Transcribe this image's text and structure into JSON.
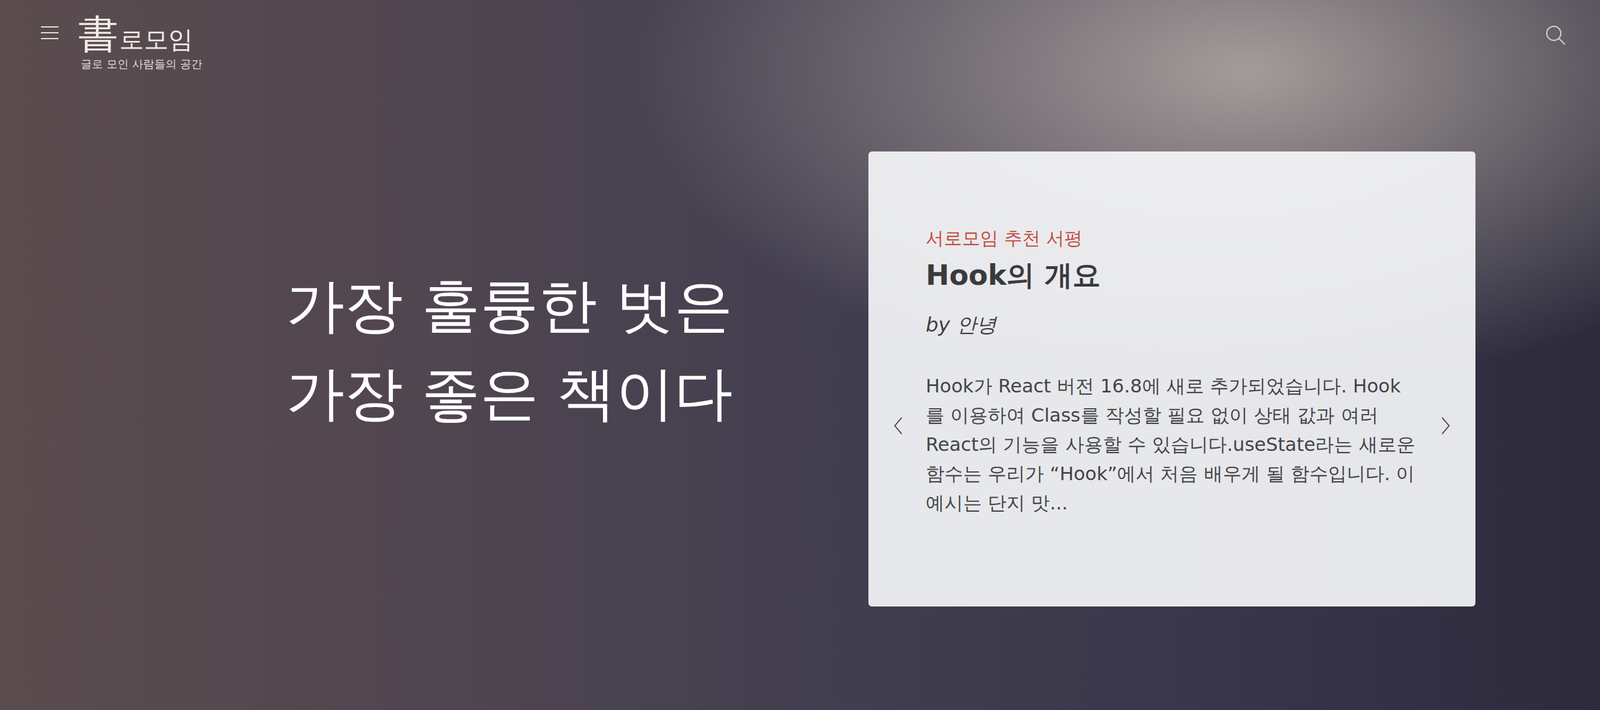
{
  "header": {
    "logo": {
      "mark": "書",
      "name": "로모임",
      "tagline": "글로 모인 사람들의 공간"
    }
  },
  "hero": {
    "lines": [
      "가장 훌륭한 벗은",
      "가장 좋은 책이다"
    ]
  },
  "card": {
    "label": "서로모임 추천 서평",
    "title": "Hook의 개요",
    "author": "by 안녕",
    "excerpt": "Hook가 React 버전 16.8에 새로 추가되었습니다. Hook를 이용하여 Class를 작성할 필요 없이 상태 값과 여러 React의 기능을 사용할 수 있습니다.useState라는 새로운 함수는 우리가 “Hook”에서 처음 배우게 될 함수입니다. 이 예시는 단지 맛..."
  }
}
